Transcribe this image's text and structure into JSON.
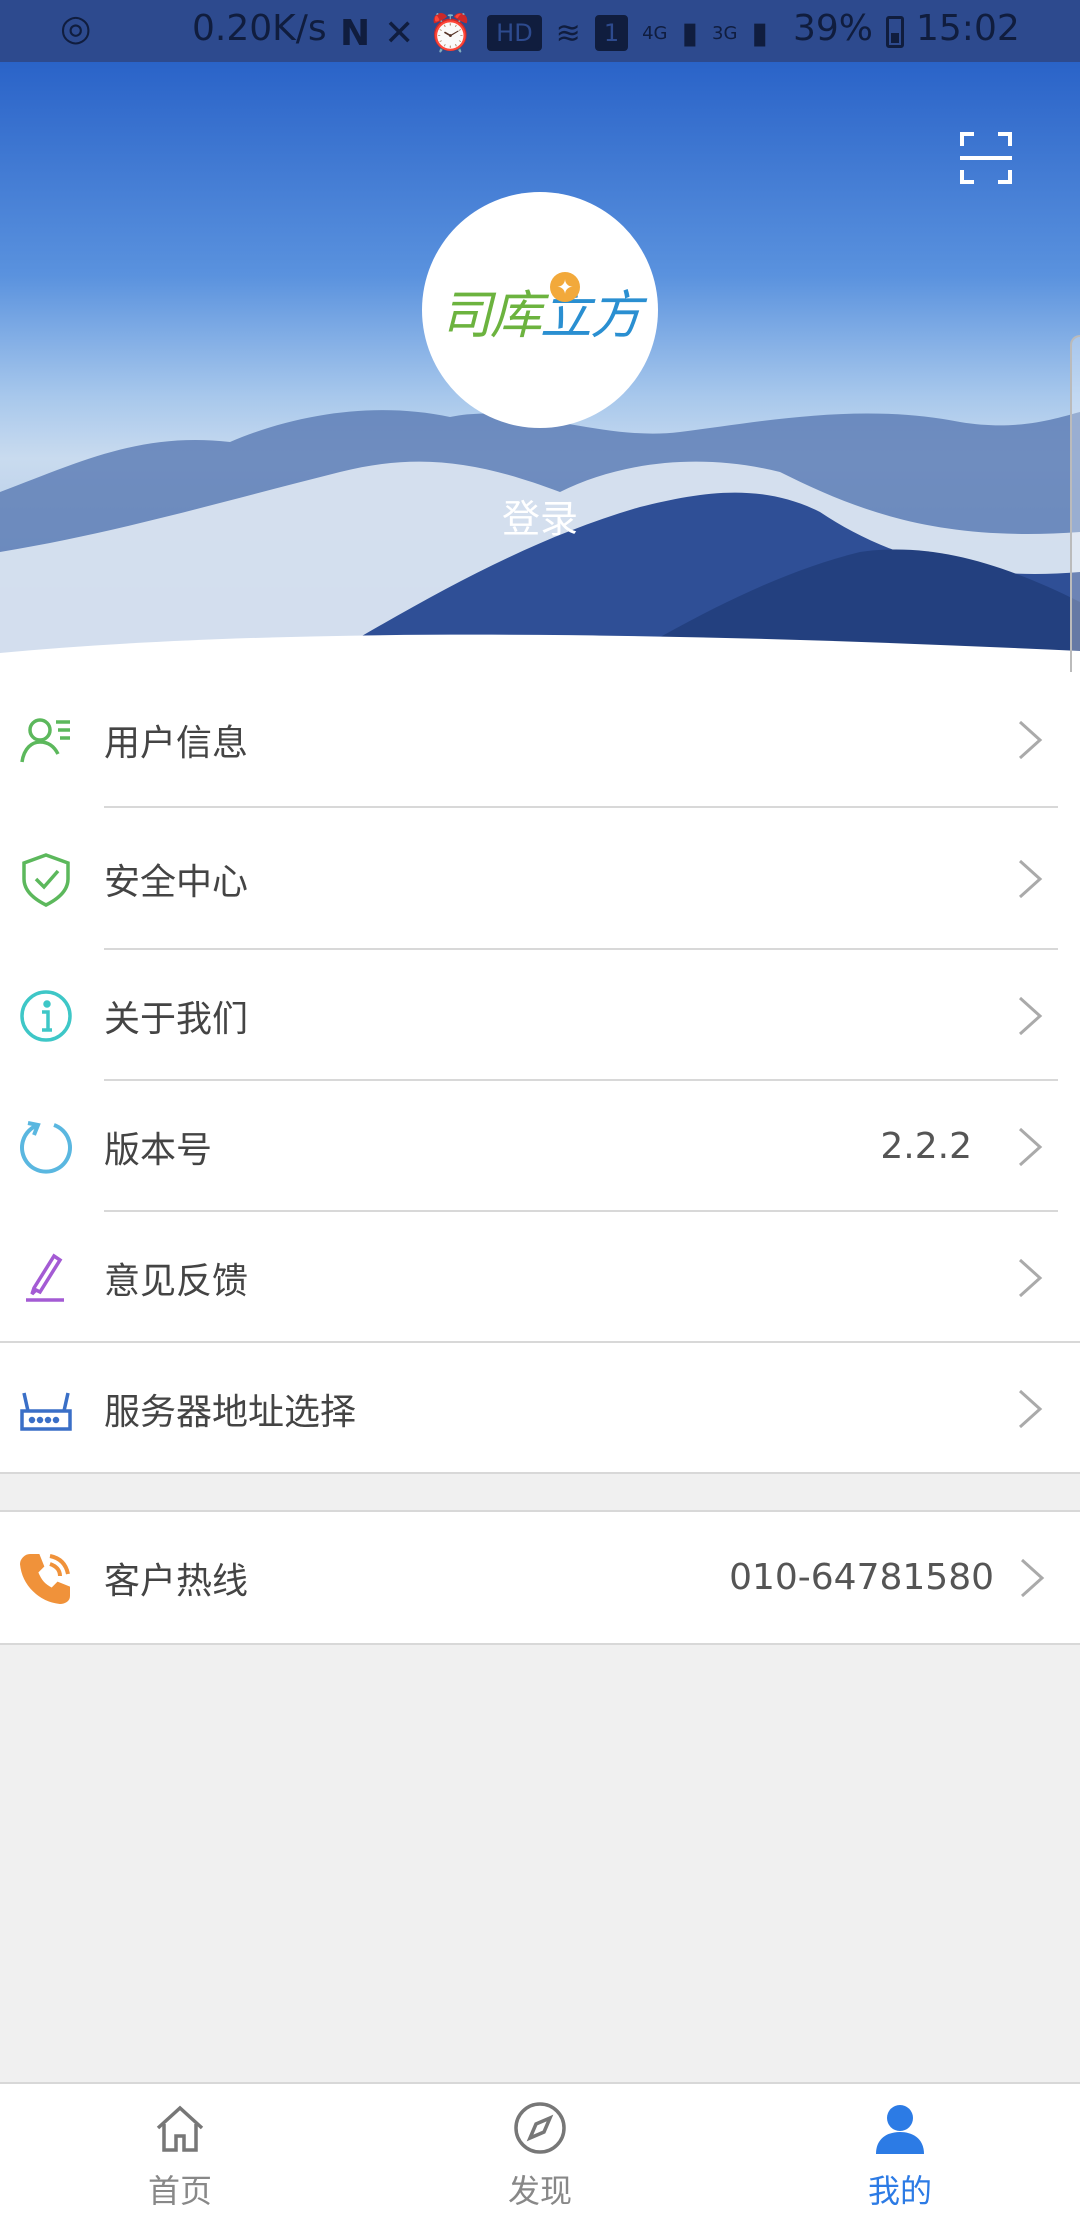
{
  "status_bar": {
    "net_speed": "0.20K/s",
    "hd_label": "HD",
    "sim1_label": "1",
    "net1": "4G",
    "net2": "3G",
    "battery": "39%",
    "time": "15:02"
  },
  "header": {
    "logo_text_a": "司库",
    "logo_text_b": "立方",
    "login_label": "登录",
    "scan_icon": "scan-icon"
  },
  "menu": {
    "items": [
      {
        "label": "用户信息",
        "icon": "user-info-icon",
        "color": "#5cb85c",
        "value": ""
      },
      {
        "label": "安全中心",
        "icon": "shield-check-icon",
        "color": "#5cb85c",
        "value": ""
      },
      {
        "label": "关于我们",
        "icon": "info-icon",
        "color": "#3ec7c7",
        "value": ""
      },
      {
        "label": "版本号",
        "icon": "refresh-icon",
        "color": "#5ab7e0",
        "value": "2.2.2"
      },
      {
        "label": "意见反馈",
        "icon": "pen-icon",
        "color": "#a45bd4",
        "value": ""
      },
      {
        "label": "服务器地址选择",
        "icon": "router-icon",
        "color": "#3a6fc7",
        "value": ""
      }
    ],
    "hotline": {
      "label": "客户热线",
      "icon": "phone-icon",
      "color": "#f0923a",
      "value": "010-64781580"
    }
  },
  "tabbar": {
    "tabs": [
      {
        "label": "首页",
        "icon": "home-icon",
        "active": false
      },
      {
        "label": "发现",
        "icon": "compass-icon",
        "active": false
      },
      {
        "label": "我的",
        "icon": "person-icon",
        "active": true
      }
    ],
    "active_color": "#2c7be5"
  }
}
